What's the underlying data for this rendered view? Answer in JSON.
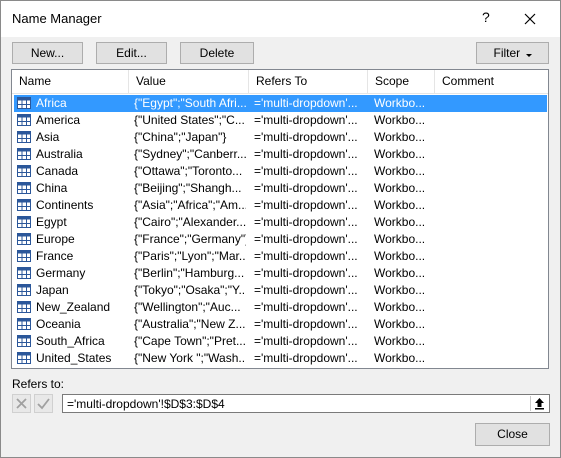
{
  "window": {
    "title": "Name Manager",
    "help_label": "?"
  },
  "toolbar": {
    "new_label": "New...",
    "edit_label": "Edit...",
    "delete_label": "Delete",
    "filter_label": "Filter"
  },
  "columns": [
    "Name",
    "Value",
    "Refers To",
    "Scope",
    "Comment"
  ],
  "rows": [
    {
      "name": "Africa",
      "value": "{\"Egypt\";\"South Afri...",
      "refers": "='multi-dropdown'...",
      "scope": "Workbo...",
      "comment": "",
      "selected": true
    },
    {
      "name": "America",
      "value": "{\"United States\";\"C...",
      "refers": "='multi-dropdown'...",
      "scope": "Workbo...",
      "comment": ""
    },
    {
      "name": "Asia",
      "value": "{\"China\";\"Japan\"}",
      "refers": "='multi-dropdown'...",
      "scope": "Workbo...",
      "comment": ""
    },
    {
      "name": "Australia",
      "value": "{\"Sydney\";\"Canberr...",
      "refers": "='multi-dropdown'...",
      "scope": "Workbo...",
      "comment": ""
    },
    {
      "name": "Canada",
      "value": "{\"Ottawa\";\"Toronto...",
      "refers": "='multi-dropdown'...",
      "scope": "Workbo...",
      "comment": ""
    },
    {
      "name": "China",
      "value": "{\"Beijing\";\"Shangh...",
      "refers": "='multi-dropdown'...",
      "scope": "Workbo...",
      "comment": ""
    },
    {
      "name": "Continents",
      "value": "{\"Asia\";\"Africa\";\"Am...",
      "refers": "='multi-dropdown'...",
      "scope": "Workbo...",
      "comment": ""
    },
    {
      "name": "Egypt",
      "value": "{\"Cairo\";\"Alexander...",
      "refers": "='multi-dropdown'...",
      "scope": "Workbo...",
      "comment": ""
    },
    {
      "name": "Europe",
      "value": "{\"France\";\"Germany\"}",
      "refers": "='multi-dropdown'...",
      "scope": "Workbo...",
      "comment": ""
    },
    {
      "name": "France",
      "value": "{\"Paris\";\"Lyon\";\"Mar...",
      "refers": "='multi-dropdown'...",
      "scope": "Workbo...",
      "comment": ""
    },
    {
      "name": "Germany",
      "value": "{\"Berlin\";\"Hamburg...",
      "refers": "='multi-dropdown'...",
      "scope": "Workbo...",
      "comment": ""
    },
    {
      "name": "Japan",
      "value": "{\"Tokyo\";\"Osaka\";\"Y...",
      "refers": "='multi-dropdown'...",
      "scope": "Workbo...",
      "comment": ""
    },
    {
      "name": "New_Zealand",
      "value": "{\"Wellington\";\"Auc...",
      "refers": "='multi-dropdown'...",
      "scope": "Workbo...",
      "comment": ""
    },
    {
      "name": "Oceania",
      "value": "{\"Australia\";\"New Z...",
      "refers": "='multi-dropdown'...",
      "scope": "Workbo...",
      "comment": ""
    },
    {
      "name": "South_Africa",
      "value": "{\"Cape Town\";\"Pret...",
      "refers": "='multi-dropdown'...",
      "scope": "Workbo...",
      "comment": ""
    },
    {
      "name": "United_States",
      "value": "{\"New York \";\"Wash...",
      "refers": "='multi-dropdown'...",
      "scope": "Workbo...",
      "comment": ""
    }
  ],
  "refers_to": {
    "label": "Refers to:",
    "value": "='multi-dropdown'!$D$3:$D$4"
  },
  "footer": {
    "close_label": "Close"
  },
  "colors": {
    "selection": "#3399ff",
    "border": "#828790",
    "dialog_bg": "#f0f0f0"
  }
}
